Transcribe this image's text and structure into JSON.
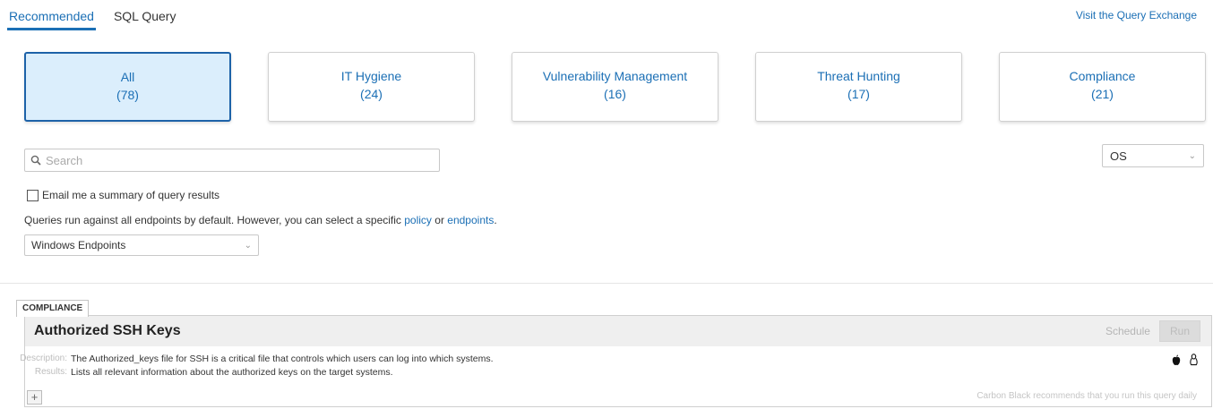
{
  "tabs": [
    {
      "label": "Recommended",
      "active": true
    },
    {
      "label": "SQL Query",
      "active": false
    }
  ],
  "exchange_link": "Visit the Query Exchange",
  "categories": [
    {
      "label": "All",
      "count": "(78)",
      "active": true
    },
    {
      "label": "IT Hygiene",
      "count": "(24)"
    },
    {
      "label": "Vulnerability Management",
      "count": "(16)"
    },
    {
      "label": "Threat Hunting",
      "count": "(17)"
    },
    {
      "label": "Compliance",
      "count": "(21)"
    }
  ],
  "search": {
    "placeholder": "Search",
    "value": ""
  },
  "os_select": {
    "value": "OS"
  },
  "email": {
    "label": "Email me a summary of query results",
    "checked": false
  },
  "info": {
    "text": "Queries run against all endpoints by default. However, you can select a specific ",
    "policy_link": "policy",
    "or": " or ",
    "endpoints_link": "endpoints",
    "end": "."
  },
  "endpoint_select": {
    "value": "Windows Endpoints"
  },
  "query_card": {
    "category": "COMPLIANCE",
    "title": "Authorized SSH Keys",
    "schedule_label": "Schedule",
    "run_label": "Run",
    "description_key": "Description:",
    "description": "The Authorized_keys file for SSH is a critical file that controls which users can log into which systems.",
    "results_key": "Results:",
    "results": "Lists all relevant information about the authorized keys on the target systems.",
    "platform_icons": [
      "apple-icon",
      "linux-icon"
    ],
    "expand_label": "+",
    "recommendation": "Carbon Black recommends that you run this query daily"
  },
  "colors": {
    "accent": "#1b6fb5",
    "active_card_bg": "#dbeefc",
    "active_card_border": "#1d62a8"
  }
}
